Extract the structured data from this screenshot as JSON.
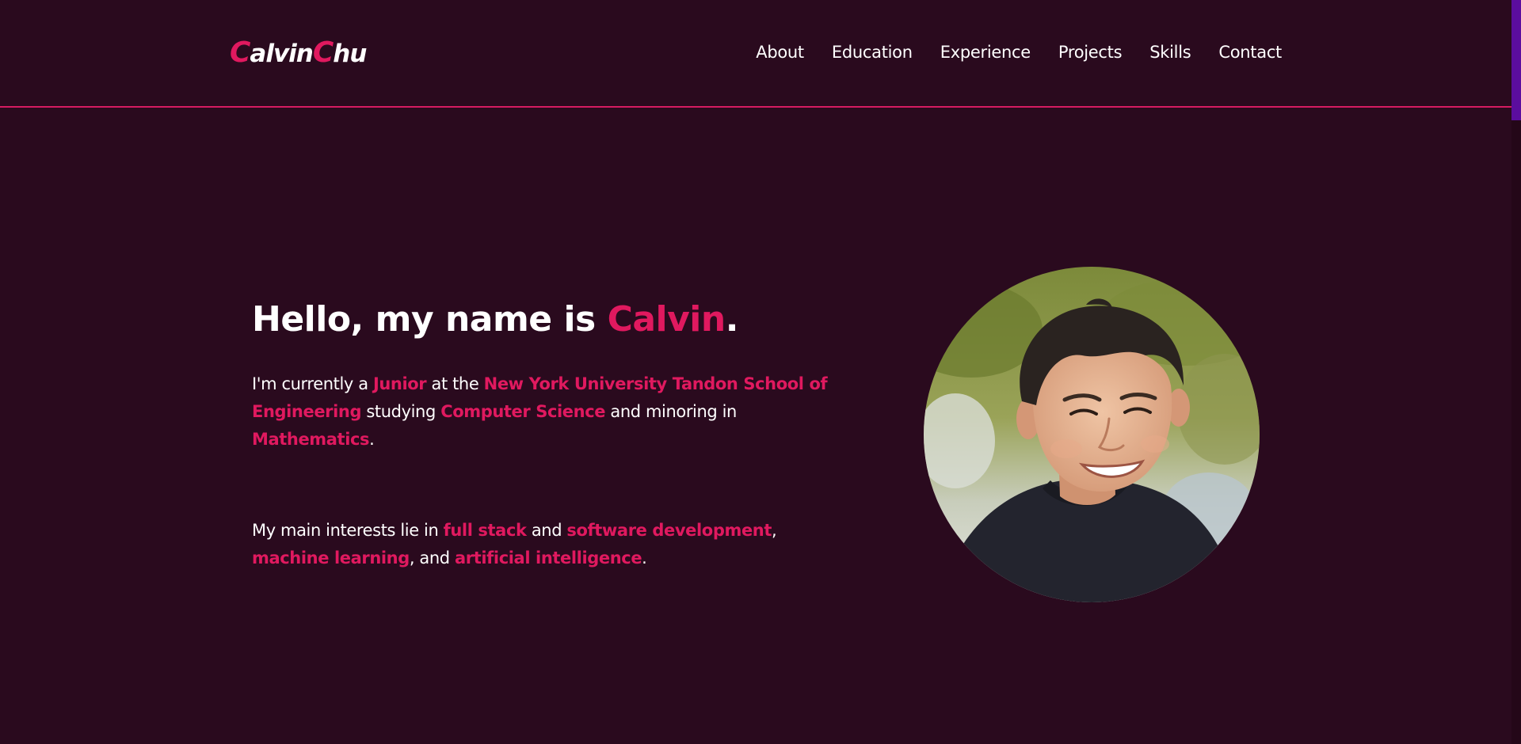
{
  "header": {
    "logo": {
      "first_initial": "C",
      "first_rest": "alvin",
      "last_initial": "C",
      "last_rest": "hu"
    },
    "nav": [
      {
        "label": "About"
      },
      {
        "label": "Education"
      },
      {
        "label": "Experience"
      },
      {
        "label": "Projects"
      },
      {
        "label": "Skills"
      },
      {
        "label": "Contact"
      }
    ]
  },
  "hero": {
    "title_prefix": "Hello, my name is ",
    "title_name": "Calvin",
    "title_suffix": ".",
    "para1": {
      "t1": "I'm currently a ",
      "h1": "Junior",
      "t2": " at the ",
      "h2": "New York University Tandon School of Engineering",
      "t3": " studying ",
      "h3": "Computer Science",
      "t4": " and minoring in ",
      "h4": "Mathematics",
      "t5": "."
    },
    "para2": {
      "t1": "My main interests lie in ",
      "h1": "full stack",
      "t2": " and ",
      "h2": "software development",
      "t3": ", ",
      "h3": "machine learning",
      "t4": ", and ",
      "h4": "artificial intelligence",
      "t5": "."
    }
  },
  "colors": {
    "background": "#2a0a1e",
    "accent": "#e0195f",
    "scrollbar_thumb": "#5b0d9e"
  },
  "icons": {
    "portrait": "profile-photo"
  }
}
